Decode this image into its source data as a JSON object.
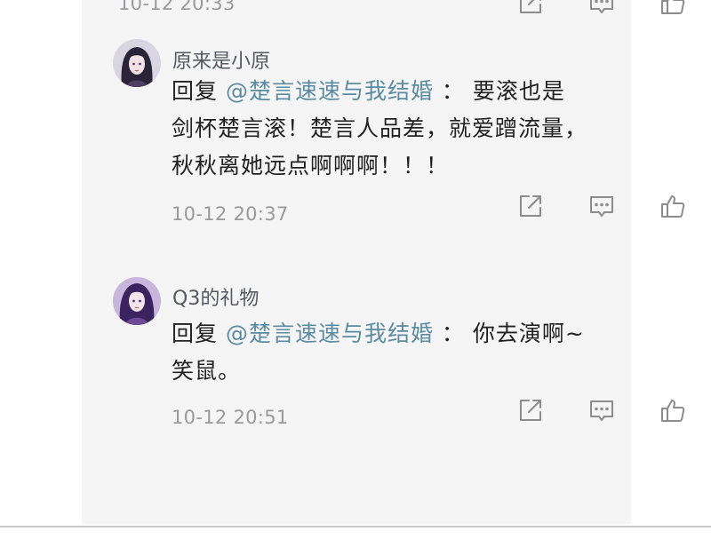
{
  "comments": [
    {
      "time": "10-12  20:33"
    },
    {
      "username": "原来是小原",
      "reply_prefix": "回复 ",
      "mention": "@楚言速速与我结婚",
      "separator": " ： ",
      "text_first": "要滚也是",
      "text_rest": "剑杯楚言滚！楚言人品差，就爱蹭流量，\n秋秋离她远点啊啊啊！！！",
      "time": "10-12  20:37"
    },
    {
      "username": "Q3的礼物",
      "reply_prefix": "回复 ",
      "mention": "@楚言速速与我结婚",
      "separator": " ： ",
      "text_first": "你去演啊~",
      "text_rest": "笑鼠。",
      "time": "10-12  20:51"
    }
  ],
  "icons": {
    "share": "share-icon",
    "comment": "comment-icon",
    "like": "thumbs-up-icon"
  },
  "colors": {
    "mention": "#5b8ba0",
    "meta": "#9a9a9a",
    "panel": "#f5f5f6"
  }
}
